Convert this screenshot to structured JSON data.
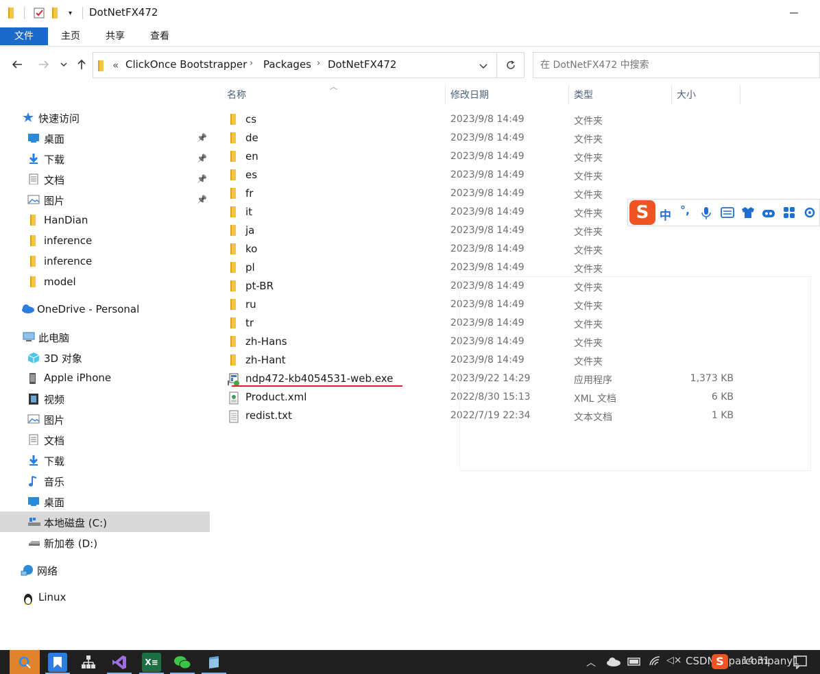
{
  "window": {
    "title": "DotNetFX472"
  },
  "ribbon": {
    "tabs": [
      "文件",
      "主页",
      "共享",
      "查看"
    ]
  },
  "address": {
    "overflow": "«",
    "crumbs": [
      "ClickOnce Bootstrapper",
      "Packages",
      "DotNetFX472"
    ],
    "search_placeholder": "在 DotNetFX472 中搜索"
  },
  "sidebar": {
    "items": [
      {
        "label": "快速访问",
        "icon": "star-icon"
      },
      {
        "label": "桌面",
        "icon": "desktop-icon",
        "pinned": true
      },
      {
        "label": "下载",
        "icon": "download-icon",
        "pinned": true
      },
      {
        "label": "文档",
        "icon": "document-icon",
        "pinned": true
      },
      {
        "label": "图片",
        "icon": "picture-icon",
        "pinned": true
      },
      {
        "label": "HanDian",
        "icon": "folder-icon"
      },
      {
        "label": "inference",
        "icon": "folder-icon"
      },
      {
        "label": "inference",
        "icon": "folder-icon"
      },
      {
        "label": "model",
        "icon": "folder-icon"
      },
      {
        "label": "OneDrive - Personal",
        "icon": "cloud-icon"
      },
      {
        "label": "此电脑",
        "icon": "computer-icon"
      },
      {
        "label": "3D 对象",
        "icon": "cube-icon"
      },
      {
        "label": "Apple iPhone",
        "icon": "phone-icon"
      },
      {
        "label": "视频",
        "icon": "video-icon"
      },
      {
        "label": "图片",
        "icon": "picture-icon"
      },
      {
        "label": "文档",
        "icon": "document-icon"
      },
      {
        "label": "下载",
        "icon": "download-icon"
      },
      {
        "label": "音乐",
        "icon": "music-icon"
      },
      {
        "label": "桌面",
        "icon": "desktop-icon"
      },
      {
        "label": "本地磁盘 (C:)",
        "icon": "drive-c-icon",
        "selected": true
      },
      {
        "label": "新加卷 (D:)",
        "icon": "drive-icon"
      },
      {
        "label": "网络",
        "icon": "network-icon"
      },
      {
        "label": "Linux",
        "icon": "linux-icon"
      }
    ]
  },
  "columns": {
    "name": "名称",
    "date": "修改日期",
    "type": "类型",
    "size": "大小"
  },
  "files": [
    {
      "name": "cs",
      "date": "2023/9/8 14:49",
      "type": "文件夹",
      "size": ""
    },
    {
      "name": "de",
      "date": "2023/9/8 14:49",
      "type": "文件夹",
      "size": ""
    },
    {
      "name": "en",
      "date": "2023/9/8 14:49",
      "type": "文件夹",
      "size": ""
    },
    {
      "name": "es",
      "date": "2023/9/8 14:49",
      "type": "文件夹",
      "size": ""
    },
    {
      "name": "fr",
      "date": "2023/9/8 14:49",
      "type": "文件夹",
      "size": ""
    },
    {
      "name": "it",
      "date": "2023/9/8 14:49",
      "type": "文件夹",
      "size": ""
    },
    {
      "name": "ja",
      "date": "2023/9/8 14:49",
      "type": "文件夹",
      "size": ""
    },
    {
      "name": "ko",
      "date": "2023/9/8 14:49",
      "type": "文件夹",
      "size": ""
    },
    {
      "name": "pl",
      "date": "2023/9/8 14:49",
      "type": "文件夹",
      "size": ""
    },
    {
      "name": "pt-BR",
      "date": "2023/9/8 14:49",
      "type": "文件夹",
      "size": ""
    },
    {
      "name": "ru",
      "date": "2023/9/8 14:49",
      "type": "文件夹",
      "size": ""
    },
    {
      "name": "tr",
      "date": "2023/9/8 14:49",
      "type": "文件夹",
      "size": ""
    },
    {
      "name": "zh-Hans",
      "date": "2023/9/8 14:49",
      "type": "文件夹",
      "size": ""
    },
    {
      "name": "zh-Hant",
      "date": "2023/9/8 14:49",
      "type": "文件夹",
      "size": ""
    },
    {
      "name": "ndp472-kb4054531-web.exe",
      "date": "2023/9/22 14:29",
      "type": "应用程序",
      "size": "1,373 KB"
    },
    {
      "name": "Product.xml",
      "date": "2022/8/30 15:13",
      "type": "XML 文档",
      "size": "6 KB"
    },
    {
      "name": "redist.txt",
      "date": "2022/7/19 22:34",
      "type": "文本文档",
      "size": "1 KB"
    }
  ],
  "ime": {
    "label": "中"
  },
  "taskbar": {
    "tray_text": "CSDN @parcompany1",
    "time": "14:31"
  }
}
